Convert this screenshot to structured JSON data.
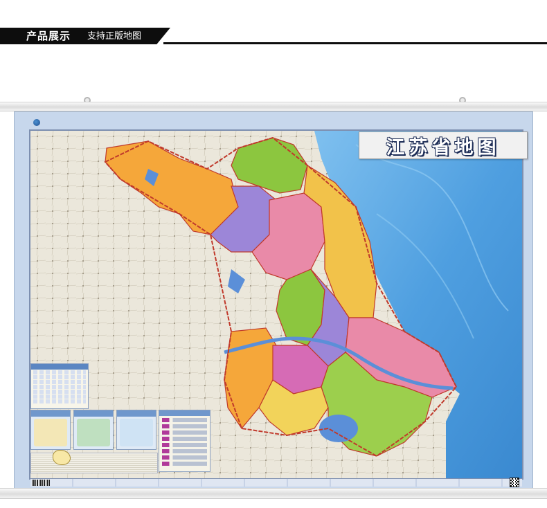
{
  "banner": {
    "title": "产品展示",
    "subtitle": "支持正版地图"
  },
  "map": {
    "title": "江苏省地图",
    "publisher_icon": "globe-logo-icon",
    "colors": {
      "sea": "#4f9fe0",
      "land_outside": "#e9e6dc",
      "lake": "#5b8fd8",
      "region_orange": "#f5a73a",
      "region_yellow": "#f2d35a",
      "region_green": "#8cc63f",
      "region_purple": "#9c86d8",
      "region_pink": "#e98aa8",
      "region_magenta": "#d66bb5"
    }
  }
}
